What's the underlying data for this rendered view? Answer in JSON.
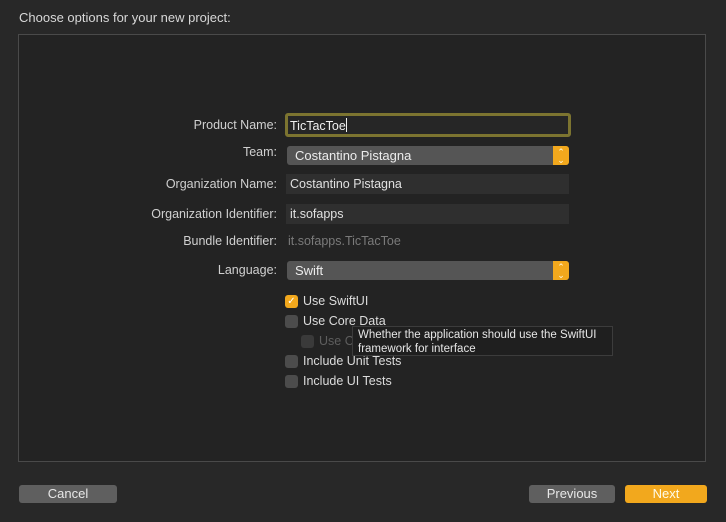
{
  "header": {
    "title": "Choose options for your new project:"
  },
  "form": {
    "product_name": {
      "label": "Product Name:",
      "value": "TicTacToe"
    },
    "team": {
      "label": "Team:",
      "selected": "Costantino Pistagna"
    },
    "organization_name": {
      "label": "Organization Name:",
      "value": "Costantino Pistagna"
    },
    "organization_identifier": {
      "label": "Organization Identifier:",
      "value": "it.sofapps"
    },
    "bundle_identifier": {
      "label": "Bundle Identifier:",
      "value": "it.sofapps.TicTacToe"
    },
    "language": {
      "label": "Language:",
      "selected": "Swift"
    }
  },
  "options": [
    {
      "label": "Use SwiftUI",
      "checked": true,
      "enabled": true
    },
    {
      "label": "Use Core Data",
      "checked": false,
      "enabled": true
    },
    {
      "label": "Use CloudKit",
      "checked": false,
      "enabled": false
    },
    {
      "label": "Include Unit Tests",
      "checked": false,
      "enabled": true
    },
    {
      "label": "Include UI Tests",
      "checked": false,
      "enabled": true
    }
  ],
  "tooltip": {
    "text": "Whether the application should use the SwiftUI framework for interface"
  },
  "icons": {
    "checkmark": "✓",
    "stepper_up": "⌃",
    "stepper_down": "⌄"
  },
  "footer": {
    "cancel_label": "Cancel",
    "previous_label": "Previous",
    "next_label": "Next"
  },
  "colors": {
    "accent": "#f2a81d",
    "background": "#282828",
    "focus_ring": "#7c7430"
  }
}
